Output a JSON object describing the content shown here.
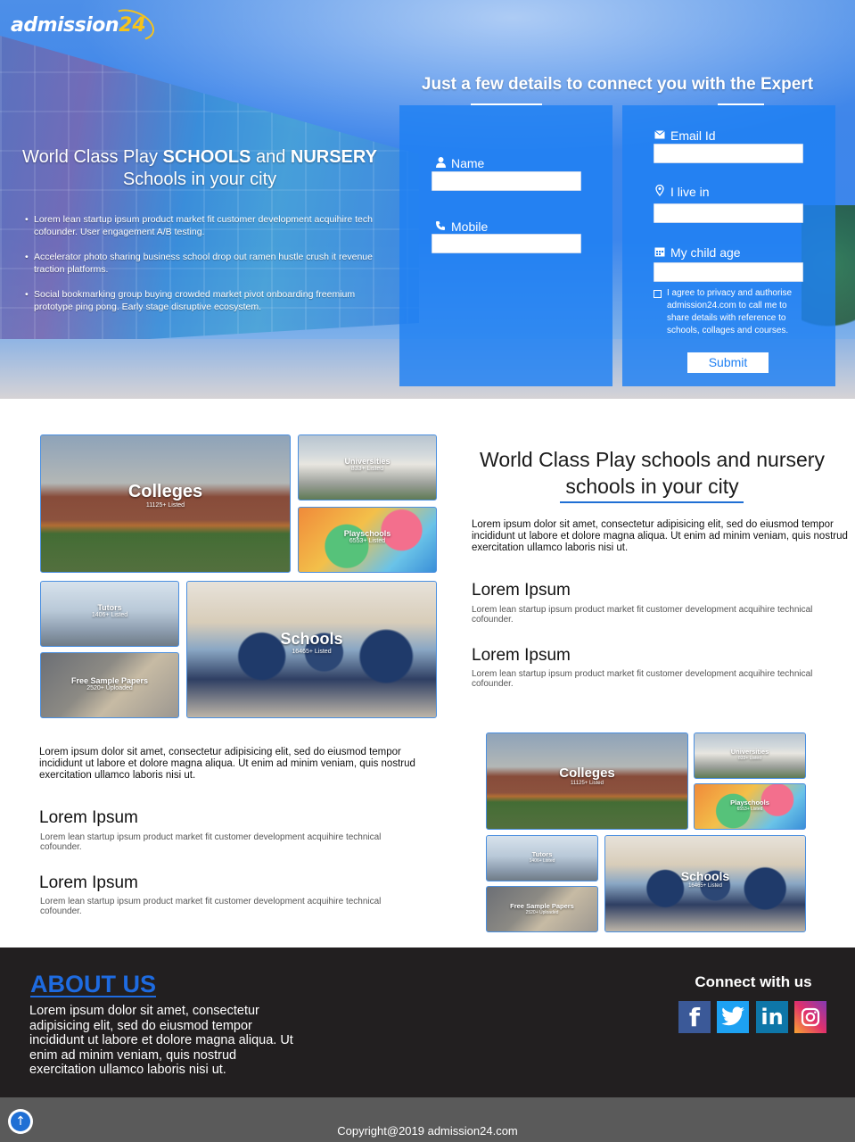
{
  "brand": {
    "logo_text": "admission",
    "logo_number": "24"
  },
  "hero": {
    "title_prefix": "World Class Play ",
    "title_bold1": "SCHOOLS",
    "title_mid": " and ",
    "title_bold2": "NURSERY",
    "title_line2": "Schools in your city",
    "bullets": [
      "Lorem lean startup ipsum product market fit customer development acquihire tech cofounder. User engagement A/B testing.",
      "Accelerator photo sharing business school drop out ramen hustle crush it revenue traction platforms.",
      "Social bookmarking group buying crowded market pivot onboarding freemium prototype ping pong. Early stage disruptive ecosystem."
    ]
  },
  "form": {
    "heading": "Just a few details to connect you with the Expert",
    "name_label": "Name",
    "mobile_label": "Mobile",
    "email_label": "Email Id",
    "city_label": "I live in",
    "age_label": "My child age",
    "agree_text": "I agree to privacy and authorise admission24.com to call me to share details with reference to schools, collages and courses.",
    "submit_label": "Submit",
    "icons": [
      "user-icon",
      "phone-icon",
      "mail-icon",
      "location-icon",
      "calendar-icon"
    ]
  },
  "categories": {
    "colleges": {
      "title": "Colleges",
      "count": "11125+ Listed"
    },
    "universities": {
      "title": "Universities",
      "count": "833+ Listed"
    },
    "playschools": {
      "title": "Playschools",
      "count": "6553+ Listed"
    },
    "tutors": {
      "title": "Tutors",
      "count": "1406+ Listed"
    },
    "papers": {
      "title": "Free Sample Papers",
      "count": "2520+ Uploaded"
    },
    "schools": {
      "title": "Schools",
      "count": "16465+ Listed"
    }
  },
  "section": {
    "title": "World Class Play schools and nursery schools in your city",
    "paragraph": "Lorem ipsum dolor sit amet, consectetur adipisicing elit, sed do eiusmod tempor incididunt ut labore et dolore magna aliqua. Ut enim ad minim veniam, quis nostrud exercitation ullamco laboris nisi ut.",
    "items": [
      {
        "heading": "Lorem Ipsum",
        "text": "Lorem lean startup ipsum product market fit customer development acquihire technical cofounder."
      },
      {
        "heading": "Lorem Ipsum",
        "text": "Lorem lean startup ipsum product market fit customer development acquihire technical cofounder."
      }
    ]
  },
  "section2": {
    "paragraph": "Lorem ipsum dolor sit amet, consectetur adipisicing elit, sed do eiusmod tempor incididunt ut labore et dolore magna aliqua. Ut enim ad minim veniam, quis nostrud exercitation ullamco laboris nisi ut.",
    "items": [
      {
        "heading": "Lorem Ipsum",
        "text": "Lorem lean startup ipsum product market fit customer development acquihire technical cofounder."
      },
      {
        "heading": "Lorem Ipsum",
        "text": "Lorem lean startup ipsum product market fit customer development acquihire technical cofounder."
      }
    ]
  },
  "footer": {
    "about_title": "ABOUT US",
    "about_text": "Lorem ipsum dolor sit amet, consectetur adipisicing elit, sed do eiusmod tempor incididunt ut labore et dolore magna aliqua. Ut enim ad minim veniam, quis nostrud exercitation ullamco laboris nisi ut.",
    "connect_title": "Connect with us",
    "social": [
      "facebook-icon",
      "twitter-icon",
      "linkedin-icon",
      "instagram-icon"
    ],
    "copyright": "Copyright@2019 admission24.com"
  },
  "colors": {
    "accent": "#1f80f3",
    "brand_yellow": "#f5c21b",
    "footer_bg": "#221f20",
    "about_title": "#1e6be0"
  }
}
